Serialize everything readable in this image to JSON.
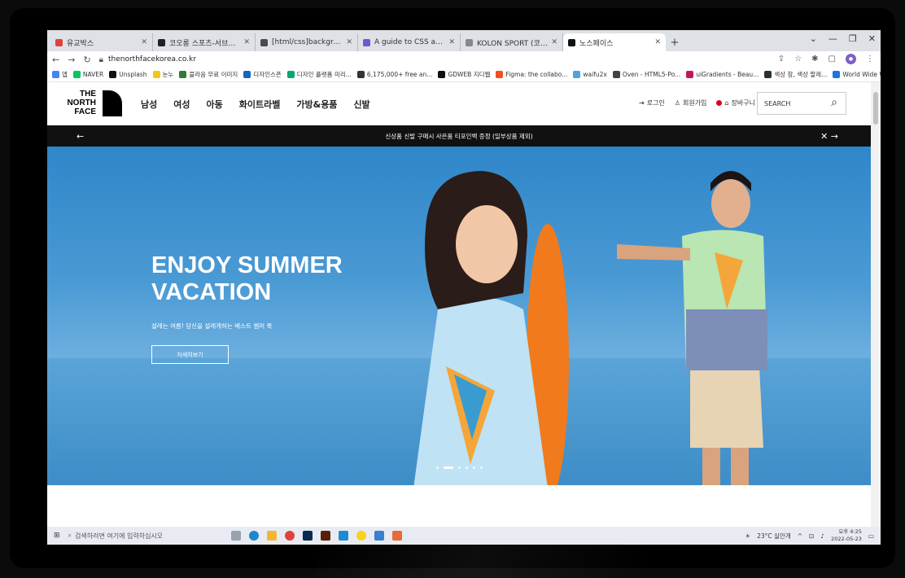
{
  "browser": {
    "tabs": [
      {
        "label": "유교박스",
        "color": "#e0413a",
        "active": false
      },
      {
        "label": "코오롱 스포츠-서브페이지",
        "color": "#222222",
        "active": false
      },
      {
        "label": "[html/css]background-position",
        "color": "#4a4a4a",
        "active": false
      },
      {
        "label": "A guide to CSS animations usi",
        "color": "#6a5acd",
        "active": false
      },
      {
        "label": "KOLON SPORT (코오롱스포츠)",
        "color": "#888888",
        "active": false
      },
      {
        "label": "노스페이스",
        "color": "#111111",
        "active": true
      }
    ],
    "url": "thenorthfacekorea.co.kr",
    "bookmarks": [
      {
        "label": "앱",
        "color": "#4285f4"
      },
      {
        "label": "NAVER",
        "color": "#03c75a"
      },
      {
        "label": "Unsplash",
        "color": "#111111"
      },
      {
        "label": "눈누",
        "color": "#f5c518"
      },
      {
        "label": "블라음 무료 이미지",
        "color": "#2e7d32"
      },
      {
        "label": "디자인스픈",
        "color": "#1565c0"
      },
      {
        "label": "디자인 플랫폼 미리...",
        "color": "#00a86b"
      },
      {
        "label": "6,175,000+ free an...",
        "color": "#333333"
      },
      {
        "label": "GDWEB 지디웹",
        "color": "#111111"
      },
      {
        "label": "Figma: the collabo...",
        "color": "#f24e1e"
      },
      {
        "label": "waifu2x",
        "color": "#4fa3e0"
      },
      {
        "label": "Oven - HTML5-Po...",
        "color": "#444444"
      },
      {
        "label": "uiGradients - Beau...",
        "color": "#c2185b"
      },
      {
        "label": "색상 참, 색상 팔레...",
        "color": "#263238"
      },
      {
        "label": "World Wide Web...",
        "color": "#1a73e8"
      }
    ]
  },
  "site": {
    "logo_lines": [
      "THE",
      "NORTH",
      "FACE"
    ],
    "nav": [
      "남성",
      "여성",
      "아동",
      "화이트라벨",
      "가방&용품",
      "신발"
    ],
    "util": {
      "login": "로그인",
      "join": "회원가입",
      "cart": "장바구니"
    },
    "search_placeholder": "SEARCH",
    "promo": "신상품 신발 구매시 사은품 티포인백 증정 (일부상품 제외)",
    "hero": {
      "title": "ENJOY SUMMER\nVACATION",
      "subtitle": "설레는 여름! 당신을 설레게하는 베스트 썸머 룩",
      "button": "자세히보기"
    }
  },
  "taskbar": {
    "search_placeholder": "검색하려면 여기에 입력하십시오",
    "weather": "23°C 실안개",
    "time": "오후 4:25",
    "date": "2022-05-23"
  }
}
